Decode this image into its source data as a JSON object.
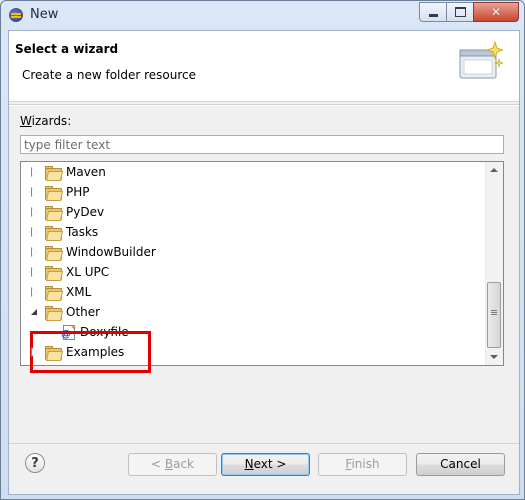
{
  "window": {
    "title": "New"
  },
  "header": {
    "title": "Select a wizard",
    "description": "Create a new folder resource"
  },
  "wizards_label_prefix": "W",
  "wizards_label_rest": "izards:",
  "filter": {
    "placeholder": "type filter text",
    "value": ""
  },
  "tree": {
    "items": [
      {
        "label": "Maven",
        "icon": "folder-icon",
        "expanded": false
      },
      {
        "label": "PHP",
        "icon": "folder-icon",
        "expanded": false
      },
      {
        "label": "PyDev",
        "icon": "folder-icon",
        "expanded": false
      },
      {
        "label": "Tasks",
        "icon": "folder-icon",
        "expanded": false
      },
      {
        "label": "WindowBuilder",
        "icon": "folder-icon",
        "expanded": false
      },
      {
        "label": "XL UPC",
        "icon": "folder-icon",
        "expanded": false
      },
      {
        "label": "XML",
        "icon": "folder-icon",
        "expanded": false
      },
      {
        "label": "Other",
        "icon": "folder-icon",
        "expanded": true
      },
      {
        "label": "Doxyfile",
        "icon": "doxyfile-icon",
        "child_of": "Other"
      },
      {
        "label": "Examples",
        "icon": "folder-icon",
        "expanded": false
      }
    ],
    "highlight_color": "#e00000"
  },
  "buttons": {
    "back": {
      "prefix": "< ",
      "mnemonic": "B",
      "rest": "ack",
      "enabled": false
    },
    "next": {
      "mnemonic": "N",
      "rest": "ext >",
      "enabled": true
    },
    "finish": {
      "mnemonic": "F",
      "rest": "inish",
      "enabled": false
    },
    "cancel": {
      "label": "Cancel",
      "enabled": true
    }
  },
  "help": {
    "glyph": "?"
  }
}
